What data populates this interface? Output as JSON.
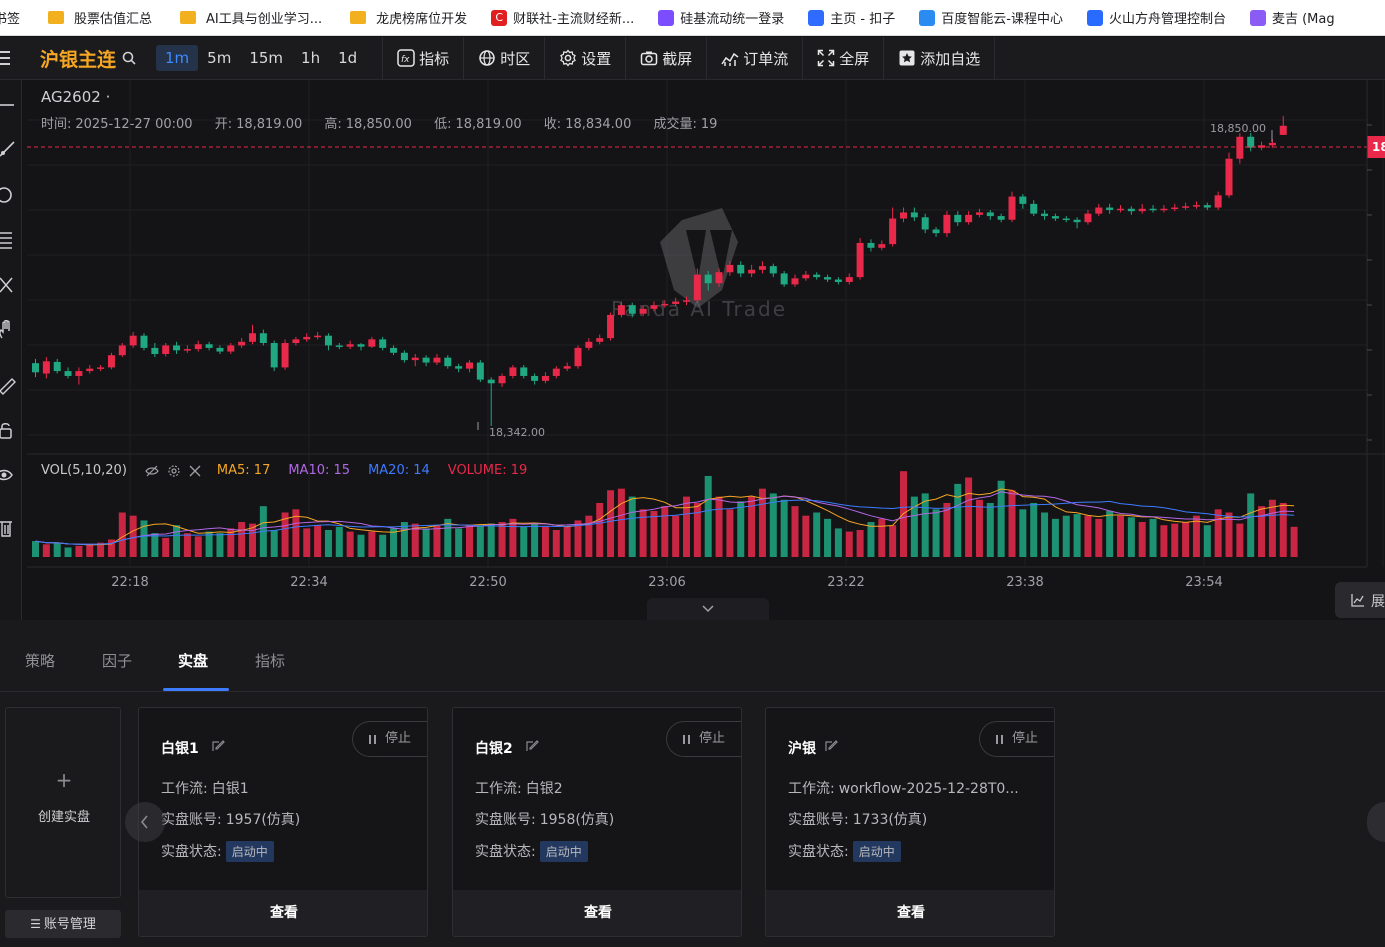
{
  "bookmarks": [
    {
      "label": "书签",
      "icon": "bookmark-icon"
    },
    {
      "label": "股票估值汇总",
      "icon": "folder-icon"
    },
    {
      "label": "AI工具与创业学习...",
      "icon": "folder-icon"
    },
    {
      "label": "龙虎榜席位开发",
      "icon": "folder-icon"
    },
    {
      "label": "财联社-主流财经新...",
      "icon": "cls-logo-icon"
    },
    {
      "label": "硅基流动统一登录",
      "icon": "siliconflow-logo-icon"
    },
    {
      "label": "主页 - 扣子",
      "icon": "coze-logo-icon"
    },
    {
      "label": "百度智能云-课程中心",
      "icon": "baidu-cloud-logo-icon"
    },
    {
      "label": "火山方舟管理控制台",
      "icon": "volcano-logo-icon"
    },
    {
      "label": "麦吉 (Mag",
      "icon": "magic-logo-icon"
    }
  ],
  "toolbar": {
    "title": "沪银主连",
    "timeframes": [
      "1m",
      "5m",
      "15m",
      "1h",
      "1d"
    ],
    "active_timeframe": "1m",
    "buttons": {
      "indicators": "指标",
      "timezone": "时区",
      "settings": "设置",
      "screenshot": "截屏",
      "orderflow": "订单流",
      "fullscreen": "全屏",
      "watchlist": "添加自选"
    }
  },
  "legend": {
    "symbol": "AG2602 ·",
    "time_label": "时间:",
    "time": "2025-12-27 00:00",
    "open_label": "开:",
    "open": "18,819.00",
    "high_label": "高:",
    "high": "18,850.00",
    "low_label": "低:",
    "low": "18,819.00",
    "close_label": "收:",
    "close": "18,834.00",
    "volume_label": "成交量:",
    "volume": "19"
  },
  "watermark": "Panda AI Trade",
  "price_marks": {
    "max_label": "18,850.00",
    "min_label": "18,342.00",
    "last_price_tag": "18"
  },
  "volume_legend": {
    "title": "VOL(5,10,20)",
    "ma5": "MA5: 17",
    "ma10": "MA10: 15",
    "ma20": "MA20: 14",
    "volume": "VOLUME: 19"
  },
  "time_axis": [
    "22:18",
    "22:34",
    "22:50",
    "23:06",
    "23:22",
    "23:38",
    "23:54"
  ],
  "colors": {
    "up": "#e8294a",
    "down": "#1fa882",
    "accent": "#3d7bff",
    "title": "#f5a623",
    "ma5": "#f5a623",
    "ma10": "#b267e6",
    "ma20": "#3d7bff",
    "volume": "#e8294a"
  },
  "expand_label": "展",
  "tabs": [
    "策略",
    "因子",
    "实盘",
    "指标"
  ],
  "active_tab": "实盘",
  "create_card": {
    "plus": "+",
    "label": "创建实盘"
  },
  "account_button": "账号管理",
  "cards": [
    {
      "name": "白银1",
      "stop": "停止",
      "workflow_label": "工作流:",
      "workflow": "白银1",
      "account_label": "实盘账号:",
      "account": "1957(仿真)",
      "status_label": "实盘状态:",
      "status": "启动中",
      "view": "查看"
    },
    {
      "name": "白银2",
      "stop": "停止",
      "workflow_label": "工作流:",
      "workflow": "白银2",
      "account_label": "实盘账号:",
      "account": "1958(仿真)",
      "status_label": "实盘状态:",
      "status": "启动中",
      "view": "查看"
    },
    {
      "name": "沪银",
      "stop": "停止",
      "workflow_label": "工作流:",
      "workflow": "workflow-2025-12-28T0...",
      "account_label": "实盘账号:",
      "account": "1733(仿真)",
      "status_label": "实盘状态:",
      "status": "启动中",
      "view": "查看"
    }
  ],
  "chart_data": {
    "type": "candlestick",
    "symbol": "AG2602",
    "price_high": 18850,
    "price_low": 18342,
    "candles": [
      {
        "o": 18445,
        "c": 18430,
        "h": 18452,
        "l": 18422
      },
      {
        "o": 18428,
        "c": 18448,
        "h": 18455,
        "l": 18420
      },
      {
        "o": 18447,
        "c": 18432,
        "h": 18452,
        "l": 18428
      },
      {
        "o": 18432,
        "c": 18424,
        "h": 18438,
        "l": 18420
      },
      {
        "o": 18424,
        "c": 18432,
        "h": 18438,
        "l": 18410
      },
      {
        "o": 18432,
        "c": 18436,
        "h": 18442,
        "l": 18428
      },
      {
        "o": 18436,
        "c": 18438,
        "h": 18442,
        "l": 18432
      },
      {
        "o": 18438,
        "c": 18458,
        "h": 18462,
        "l": 18435
      },
      {
        "o": 18458,
        "c": 18474,
        "h": 18478,
        "l": 18455
      },
      {
        "o": 18474,
        "c": 18490,
        "h": 18496,
        "l": 18470
      },
      {
        "o": 18490,
        "c": 18470,
        "h": 18494,
        "l": 18466
      },
      {
        "o": 18470,
        "c": 18460,
        "h": 18478,
        "l": 18455
      },
      {
        "o": 18460,
        "c": 18474,
        "h": 18478,
        "l": 18456
      },
      {
        "o": 18474,
        "c": 18466,
        "h": 18480,
        "l": 18460
      },
      {
        "o": 18466,
        "c": 18468,
        "h": 18474,
        "l": 18462
      },
      {
        "o": 18468,
        "c": 18476,
        "h": 18482,
        "l": 18464
      },
      {
        "o": 18476,
        "c": 18470,
        "h": 18480,
        "l": 18466
      },
      {
        "o": 18470,
        "c": 18464,
        "h": 18474,
        "l": 18460
      },
      {
        "o": 18464,
        "c": 18474,
        "h": 18478,
        "l": 18460
      },
      {
        "o": 18474,
        "c": 18480,
        "h": 18486,
        "l": 18470
      },
      {
        "o": 18480,
        "c": 18494,
        "h": 18508,
        "l": 18476
      },
      {
        "o": 18494,
        "c": 18478,
        "h": 18500,
        "l": 18474
      },
      {
        "o": 18478,
        "c": 18438,
        "h": 18482,
        "l": 18432
      },
      {
        "o": 18438,
        "c": 18478,
        "h": 18484,
        "l": 18434
      },
      {
        "o": 18478,
        "c": 18484,
        "h": 18488,
        "l": 18474
      },
      {
        "o": 18484,
        "c": 18488,
        "h": 18494,
        "l": 18480
      },
      {
        "o": 18488,
        "c": 18490,
        "h": 18496,
        "l": 18484
      },
      {
        "o": 18490,
        "c": 18474,
        "h": 18494,
        "l": 18466
      },
      {
        "o": 18474,
        "c": 18472,
        "h": 18478,
        "l": 18468
      },
      {
        "o": 18472,
        "c": 18476,
        "h": 18482,
        "l": 18468
      },
      {
        "o": 18476,
        "c": 18472,
        "h": 18478,
        "l": 18466
      },
      {
        "o": 18472,
        "c": 18484,
        "h": 18488,
        "l": 18470
      },
      {
        "o": 18484,
        "c": 18470,
        "h": 18488,
        "l": 18466
      },
      {
        "o": 18470,
        "c": 18462,
        "h": 18474,
        "l": 18458
      },
      {
        "o": 18462,
        "c": 18450,
        "h": 18466,
        "l": 18446
      },
      {
        "o": 18450,
        "c": 18454,
        "h": 18460,
        "l": 18440
      },
      {
        "o": 18454,
        "c": 18446,
        "h": 18458,
        "l": 18440
      },
      {
        "o": 18446,
        "c": 18454,
        "h": 18460,
        "l": 18442
      },
      {
        "o": 18454,
        "c": 18440,
        "h": 18458,
        "l": 18436
      },
      {
        "o": 18440,
        "c": 18436,
        "h": 18444,
        "l": 18430
      },
      {
        "o": 18436,
        "c": 18446,
        "h": 18450,
        "l": 18430
      },
      {
        "o": 18446,
        "c": 18418,
        "h": 18450,
        "l": 18414
      },
      {
        "o": 18418,
        "c": 18412,
        "h": 18422,
        "l": 18342
      },
      {
        "o": 18412,
        "c": 18424,
        "h": 18428,
        "l": 18406
      },
      {
        "o": 18424,
        "c": 18438,
        "h": 18442,
        "l": 18420
      },
      {
        "o": 18438,
        "c": 18424,
        "h": 18442,
        "l": 18420
      },
      {
        "o": 18424,
        "c": 18416,
        "h": 18428,
        "l": 18410
      },
      {
        "o": 18416,
        "c": 18424,
        "h": 18430,
        "l": 18412
      },
      {
        "o": 18424,
        "c": 18436,
        "h": 18440,
        "l": 18420
      },
      {
        "o": 18436,
        "c": 18440,
        "h": 18446,
        "l": 18432
      },
      {
        "o": 18440,
        "c": 18470,
        "h": 18474,
        "l": 18436
      },
      {
        "o": 18470,
        "c": 18480,
        "h": 18486,
        "l": 18466
      },
      {
        "o": 18480,
        "c": 18486,
        "h": 18492,
        "l": 18476
      },
      {
        "o": 18486,
        "c": 18524,
        "h": 18528,
        "l": 18482
      },
      {
        "o": 18524,
        "c": 18540,
        "h": 18546,
        "l": 18520
      },
      {
        "o": 18540,
        "c": 18526,
        "h": 18544,
        "l": 18520
      },
      {
        "o": 18526,
        "c": 18534,
        "h": 18540,
        "l": 18522
      },
      {
        "o": 18534,
        "c": 18540,
        "h": 18546,
        "l": 18530
      },
      {
        "o": 18540,
        "c": 18542,
        "h": 18548,
        "l": 18536
      },
      {
        "o": 18542,
        "c": 18546,
        "h": 18552,
        "l": 18538
      },
      {
        "o": 18546,
        "c": 18548,
        "h": 18554,
        "l": 18540
      },
      {
        "o": 18548,
        "c": 18590,
        "h": 18600,
        "l": 18544
      },
      {
        "o": 18590,
        "c": 18576,
        "h": 18596,
        "l": 18564
      },
      {
        "o": 18576,
        "c": 18594,
        "h": 18600,
        "l": 18570
      },
      {
        "o": 18594,
        "c": 18606,
        "h": 18612,
        "l": 18588
      },
      {
        "o": 18606,
        "c": 18592,
        "h": 18612,
        "l": 18586
      },
      {
        "o": 18592,
        "c": 18598,
        "h": 18606,
        "l": 18586
      },
      {
        "o": 18598,
        "c": 18604,
        "h": 18612,
        "l": 18592
      },
      {
        "o": 18604,
        "c": 18592,
        "h": 18608,
        "l": 18586
      },
      {
        "o": 18592,
        "c": 18574,
        "h": 18596,
        "l": 18570
      },
      {
        "o": 18574,
        "c": 18584,
        "h": 18590,
        "l": 18570
      },
      {
        "o": 18584,
        "c": 18590,
        "h": 18596,
        "l": 18580
      },
      {
        "o": 18590,
        "c": 18586,
        "h": 18594,
        "l": 18582
      },
      {
        "o": 18586,
        "c": 18582,
        "h": 18590,
        "l": 18578
      },
      {
        "o": 18582,
        "c": 18578,
        "h": 18586,
        "l": 18574
      },
      {
        "o": 18578,
        "c": 18586,
        "h": 18592,
        "l": 18574
      },
      {
        "o": 18586,
        "c": 18642,
        "h": 18650,
        "l": 18582
      },
      {
        "o": 18642,
        "c": 18634,
        "h": 18648,
        "l": 18628
      },
      {
        "o": 18634,
        "c": 18640,
        "h": 18646,
        "l": 18630
      },
      {
        "o": 18640,
        "c": 18682,
        "h": 18700,
        "l": 18636
      },
      {
        "o": 18682,
        "c": 18692,
        "h": 18700,
        "l": 18676
      },
      {
        "o": 18692,
        "c": 18684,
        "h": 18700,
        "l": 18678
      },
      {
        "o": 18684,
        "c": 18664,
        "h": 18690,
        "l": 18658
      },
      {
        "o": 18664,
        "c": 18658,
        "h": 18668,
        "l": 18652
      },
      {
        "o": 18658,
        "c": 18688,
        "h": 18694,
        "l": 18652
      },
      {
        "o": 18688,
        "c": 18676,
        "h": 18694,
        "l": 18670
      },
      {
        "o": 18676,
        "c": 18688,
        "h": 18694,
        "l": 18672
      },
      {
        "o": 18688,
        "c": 18692,
        "h": 18698,
        "l": 18684
      },
      {
        "o": 18692,
        "c": 18686,
        "h": 18696,
        "l": 18680
      },
      {
        "o": 18686,
        "c": 18680,
        "h": 18690,
        "l": 18676
      },
      {
        "o": 18680,
        "c": 18718,
        "h": 18726,
        "l": 18676
      },
      {
        "o": 18718,
        "c": 18706,
        "h": 18722,
        "l": 18698
      },
      {
        "o": 18706,
        "c": 18690,
        "h": 18712,
        "l": 18686
      },
      {
        "o": 18690,
        "c": 18686,
        "h": 18696,
        "l": 18680
      },
      {
        "o": 18686,
        "c": 18682,
        "h": 18690,
        "l": 18678
      },
      {
        "o": 18682,
        "c": 18680,
        "h": 18686,
        "l": 18676
      },
      {
        "o": 18680,
        "c": 18676,
        "h": 18684,
        "l": 18666
      },
      {
        "o": 18676,
        "c": 18690,
        "h": 18696,
        "l": 18672
      },
      {
        "o": 18690,
        "c": 18700,
        "h": 18706,
        "l": 18686
      },
      {
        "o": 18700,
        "c": 18696,
        "h": 18706,
        "l": 18690
      },
      {
        "o": 18696,
        "c": 18698,
        "h": 18704,
        "l": 18692
      },
      {
        "o": 18698,
        "c": 18694,
        "h": 18702,
        "l": 18688
      },
      {
        "o": 18694,
        "c": 18698,
        "h": 18706,
        "l": 18690
      },
      {
        "o": 18698,
        "c": 18696,
        "h": 18704,
        "l": 18692
      },
      {
        "o": 18696,
        "c": 18698,
        "h": 18704,
        "l": 18692
      },
      {
        "o": 18698,
        "c": 18700,
        "h": 18706,
        "l": 18694
      },
      {
        "o": 18700,
        "c": 18702,
        "h": 18708,
        "l": 18696
      },
      {
        "o": 18702,
        "c": 18704,
        "h": 18710,
        "l": 18698
      },
      {
        "o": 18704,
        "c": 18700,
        "h": 18708,
        "l": 18696
      },
      {
        "o": 18700,
        "c": 18720,
        "h": 18726,
        "l": 18696
      },
      {
        "o": 18720,
        "c": 18780,
        "h": 18790,
        "l": 18716
      },
      {
        "o": 18780,
        "c": 18816,
        "h": 18822,
        "l": 18772
      },
      {
        "o": 18816,
        "c": 18798,
        "h": 18822,
        "l": 18792
      },
      {
        "o": 18798,
        "c": 18802,
        "h": 18808,
        "l": 18794
      },
      {
        "o": 18802,
        "c": 18806,
        "h": 18812,
        "l": 18798
      },
      {
        "o": 18819,
        "c": 18834,
        "h": 18850,
        "l": 18819
      }
    ],
    "volume": [
      10,
      8,
      9,
      6,
      7,
      8,
      9,
      11,
      28,
      26,
      23,
      15,
      12,
      20,
      15,
      13,
      16,
      15,
      18,
      22,
      21,
      32,
      17,
      28,
      30,
      18,
      20,
      17,
      19,
      16,
      14,
      16,
      14,
      18,
      22,
      21,
      18,
      20,
      24,
      18,
      20,
      20,
      21,
      22,
      24,
      19,
      21,
      19,
      17,
      19,
      23,
      26,
      34,
      42,
      43,
      38,
      30,
      29,
      32,
      26,
      38,
      34,
      51,
      38,
      30,
      35,
      38,
      43,
      40,
      36,
      32,
      26,
      28,
      24,
      18,
      16,
      17,
      22,
      24,
      20,
      54,
      38,
      40,
      30,
      34,
      46,
      50,
      36,
      34,
      48,
      42,
      30,
      34,
      28,
      24,
      26,
      27,
      26,
      24,
      29,
      26,
      25,
      22,
      24,
      20,
      21,
      22,
      26,
      20,
      30,
      28,
      21,
      40,
      32,
      36,
      34,
      19
    ]
  }
}
